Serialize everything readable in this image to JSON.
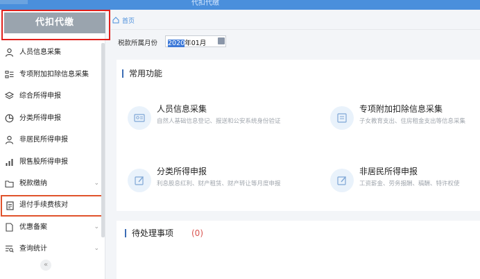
{
  "app": {
    "title": "代扣代缴"
  },
  "sidebar": {
    "header": "代扣代缴",
    "items": [
      {
        "label": "人员信息采集",
        "icon": "person-icon",
        "has_chevron": false
      },
      {
        "label": "专项附加扣除信息采集",
        "icon": "list-icon",
        "has_chevron": false
      },
      {
        "label": "综合所得申报",
        "icon": "layers-icon",
        "has_chevron": false
      },
      {
        "label": "分类所得申报",
        "icon": "pie-icon",
        "has_chevron": false
      },
      {
        "label": "非居民所得申报",
        "icon": "person-icon",
        "has_chevron": false
      },
      {
        "label": "限售股所得申报",
        "icon": "bar-chart-icon",
        "has_chevron": false
      },
      {
        "label": "税款缴纳",
        "icon": "folder-icon",
        "has_chevron": true
      },
      {
        "label": "退付手续费核对",
        "icon": "document-icon",
        "has_chevron": false,
        "highlighted": true
      },
      {
        "label": "优惠备案",
        "icon": "file-icon",
        "has_chevron": true
      },
      {
        "label": "查询统计",
        "icon": "search-list-icon",
        "has_chevron": true
      }
    ],
    "collapse_glyph": "«"
  },
  "breadcrumb": {
    "home_label": "首页"
  },
  "filter": {
    "label": "税款所属月份",
    "value_selected": "2020",
    "value_rest": "年01月"
  },
  "common_functions": {
    "title": "常用功能",
    "cards": [
      {
        "title": "人员信息采集",
        "desc": "自然人基础信息登记、报送和公安系统身份验证"
      },
      {
        "title": "专项附加扣除信息采集",
        "desc": "子女教育支出、住房租金支出等信息采集"
      },
      {
        "title": "分类所得申报",
        "desc": "利息股息红利、财产租赁、财产转让等月度申报"
      },
      {
        "title": "非居民所得申报",
        "desc": "工资薪金、劳务报酬、稿酬、特许权使"
      }
    ]
  },
  "pending": {
    "title": "待处理事项",
    "count": "(0)"
  },
  "colors": {
    "accent": "#4a8fdc",
    "highlight_border": "#e0522b",
    "alert": "#d9534f"
  }
}
